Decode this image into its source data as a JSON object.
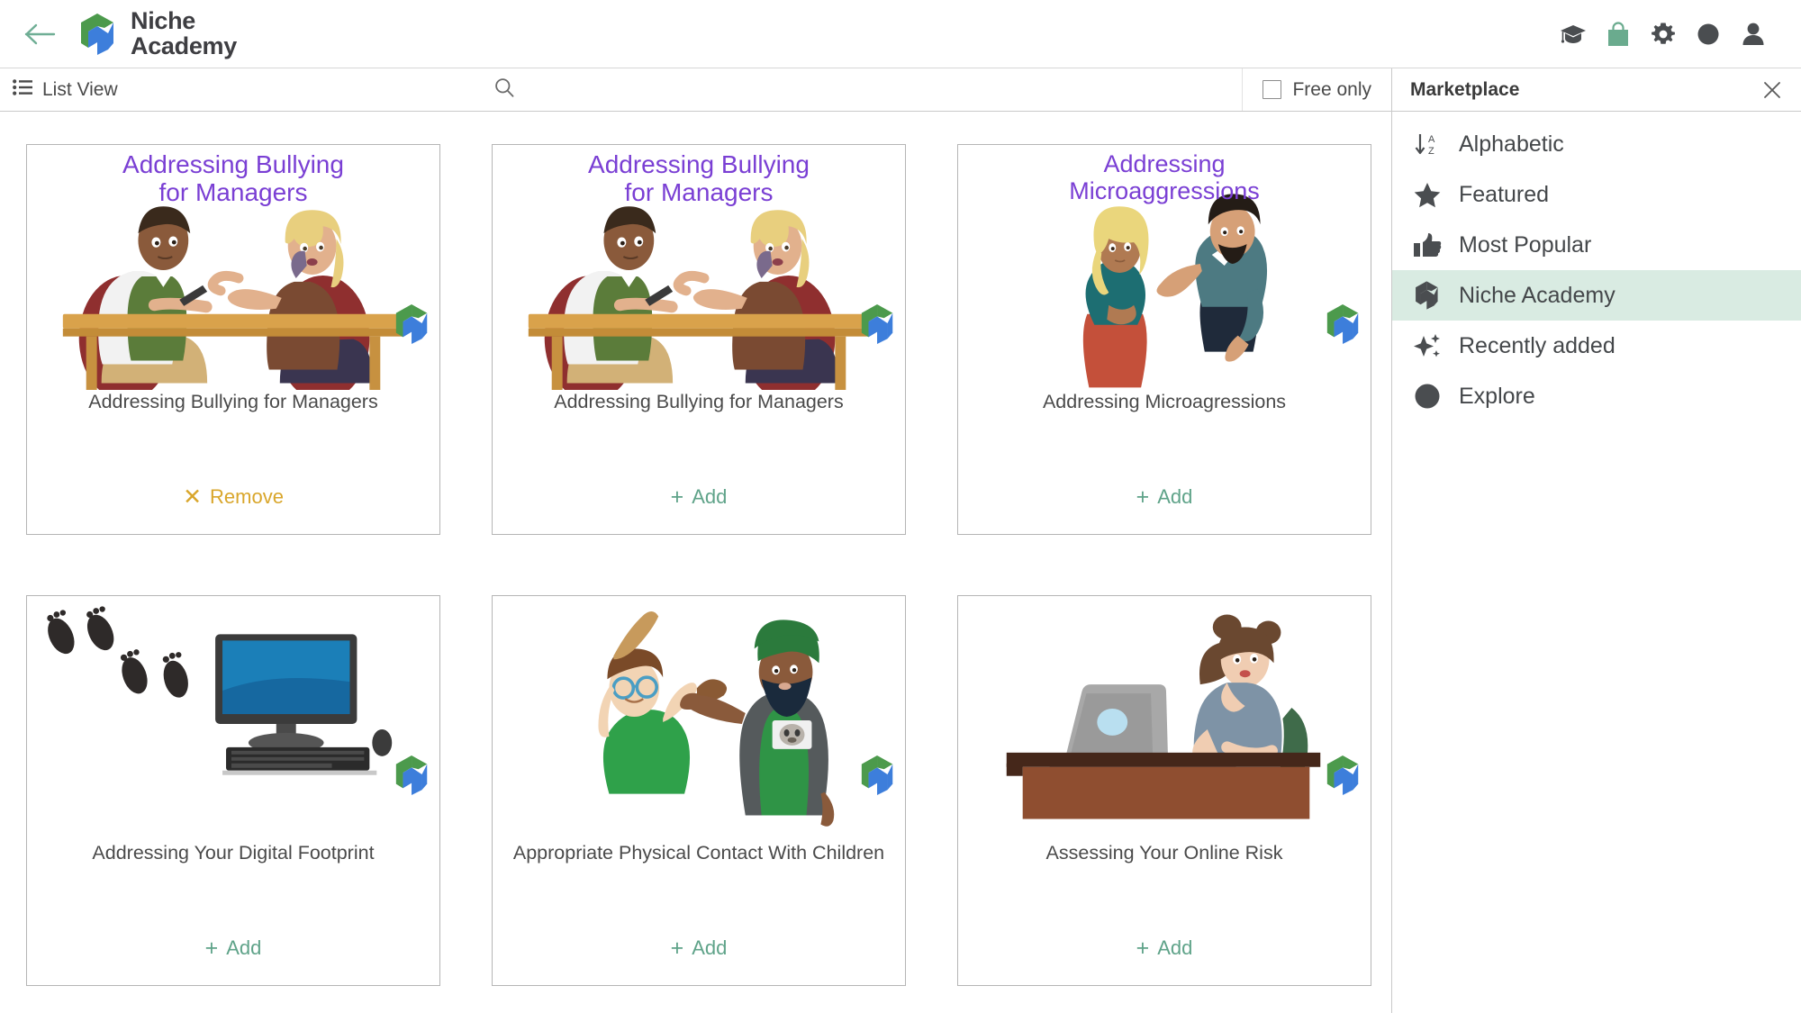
{
  "header": {
    "back_icon": "back-arrow-icon",
    "brand_line1": "Niche",
    "brand_line2": "Academy",
    "icons": [
      {
        "name": "graduation-cap-icon",
        "color": "#4a4d50"
      },
      {
        "name": "shopping-bag-icon",
        "color": "#6aab8e"
      },
      {
        "name": "gear-icon",
        "color": "#4a4d50"
      },
      {
        "name": "circle-icon",
        "color": "#4a4d50"
      },
      {
        "name": "user-avatar-icon",
        "color": "#4a4d50"
      }
    ]
  },
  "toolbar": {
    "list_view_label": "List View",
    "list_view_icon": "list-view-icon",
    "search_icon": "search-icon",
    "search_value": "",
    "search_placeholder": "",
    "free_only_label": "Free only",
    "free_only_checked": false
  },
  "marketplace": {
    "title": "Marketplace",
    "close_icon": "close-icon",
    "items": [
      {
        "label": "Alphabetic",
        "icon": "sort-alphabetic-icon",
        "active": false
      },
      {
        "label": "Featured",
        "icon": "star-icon",
        "active": false
      },
      {
        "label": "Most Popular",
        "icon": "thumbs-up-icon",
        "active": false
      },
      {
        "label": "Niche Academy",
        "icon": "niche-academy-logo-icon",
        "active": true
      },
      {
        "label": "Recently added",
        "icon": "sparkle-icon",
        "active": false
      },
      {
        "label": "Explore",
        "icon": "circle-icon",
        "active": false
      }
    ]
  },
  "colors": {
    "accent_green": "#5fa389",
    "remove_gold": "#d9a62b",
    "highlight_row": "#d9ebe2",
    "thumb_caption_purple": "#7a3fd4",
    "logo_green": "#4c9a4c",
    "logo_blue": "#3d7edb"
  },
  "cards": [
    {
      "title": "Addressing Bullying for Managers",
      "thumb_caption_line1": "Addressing Bullying",
      "thumb_caption_line2": "for Managers",
      "art": "two-people-at-table",
      "action_label": "Remove",
      "action_type": "remove",
      "action_glyph": "✕"
    },
    {
      "title": "Addressing Bullying for Managers",
      "thumb_caption_line1": "Addressing Bullying",
      "thumb_caption_line2": "for Managers",
      "art": "two-people-at-table",
      "action_label": "Add",
      "action_type": "add",
      "action_glyph": "+"
    },
    {
      "title": "Addressing Microagressions",
      "thumb_caption_line1": "Addressing",
      "thumb_caption_line2": "Microaggressions",
      "art": "two-people-standing",
      "action_label": "Add",
      "action_type": "add",
      "action_glyph": "+"
    },
    {
      "title": "Addressing Your Digital Footprint",
      "thumb_caption_line1": "",
      "thumb_caption_line2": "",
      "art": "footprints-computer",
      "action_label": "Add",
      "action_type": "add",
      "action_glyph": "+"
    },
    {
      "title": "Appropriate Physical Contact With Children",
      "thumb_caption_line1": "",
      "thumb_caption_line2": "",
      "art": "boy-and-man",
      "action_label": "Add",
      "action_type": "add",
      "action_glyph": "+"
    },
    {
      "title": "Assessing Your Online Risk",
      "thumb_caption_line1": "",
      "thumb_caption_line2": "",
      "art": "woman-at-desk-laptop",
      "action_label": "Add",
      "action_type": "add",
      "action_glyph": "+"
    }
  ]
}
